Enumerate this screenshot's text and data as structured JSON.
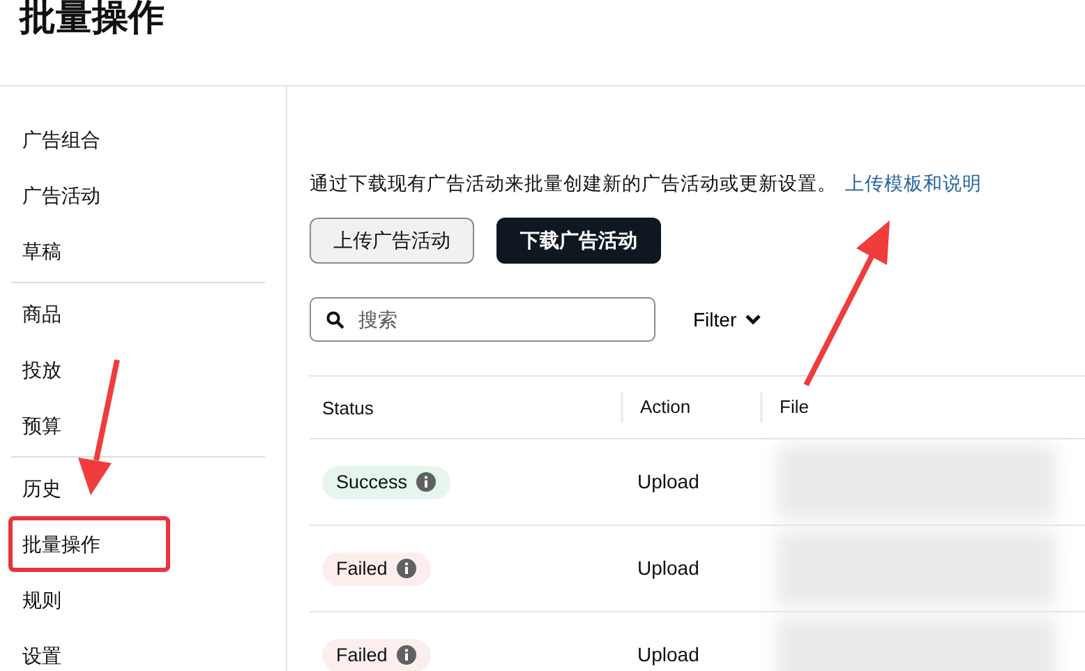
{
  "page_title": "批量操作",
  "sidebar": {
    "groups": [
      {
        "items": [
          {
            "label": "广告组合",
            "highlighted": false
          },
          {
            "label": "广告活动",
            "highlighted": false
          },
          {
            "label": "草稿",
            "highlighted": false
          }
        ]
      },
      {
        "items": [
          {
            "label": "商品",
            "highlighted": false
          },
          {
            "label": "投放",
            "highlighted": false
          },
          {
            "label": "预算",
            "highlighted": false
          }
        ]
      },
      {
        "items": [
          {
            "label": "历史",
            "highlighted": false
          },
          {
            "label": "批量操作",
            "highlighted": true
          },
          {
            "label": "规则",
            "highlighted": false
          },
          {
            "label": "设置",
            "highlighted": false
          }
        ]
      }
    ]
  },
  "description": "通过下载现有广告活动来批量创建新的广告活动或更新设置。",
  "description_link": "上传模板和说明",
  "buttons": [
    {
      "label": "上传广告活动",
      "kind": "secondary"
    },
    {
      "label": "下载广告活动",
      "kind": "primary"
    }
  ],
  "search": {
    "placeholder": "搜索"
  },
  "filter": {
    "label": "Filter"
  },
  "table": {
    "columns": [
      "Status",
      "Action",
      "File"
    ],
    "rows": [
      {
        "status": "Success",
        "kind": "success",
        "action": "Upload"
      },
      {
        "status": "Failed",
        "kind": "failed",
        "action": "Upload"
      },
      {
        "status": "Failed",
        "kind": "failed",
        "action": "Upload"
      }
    ]
  }
}
